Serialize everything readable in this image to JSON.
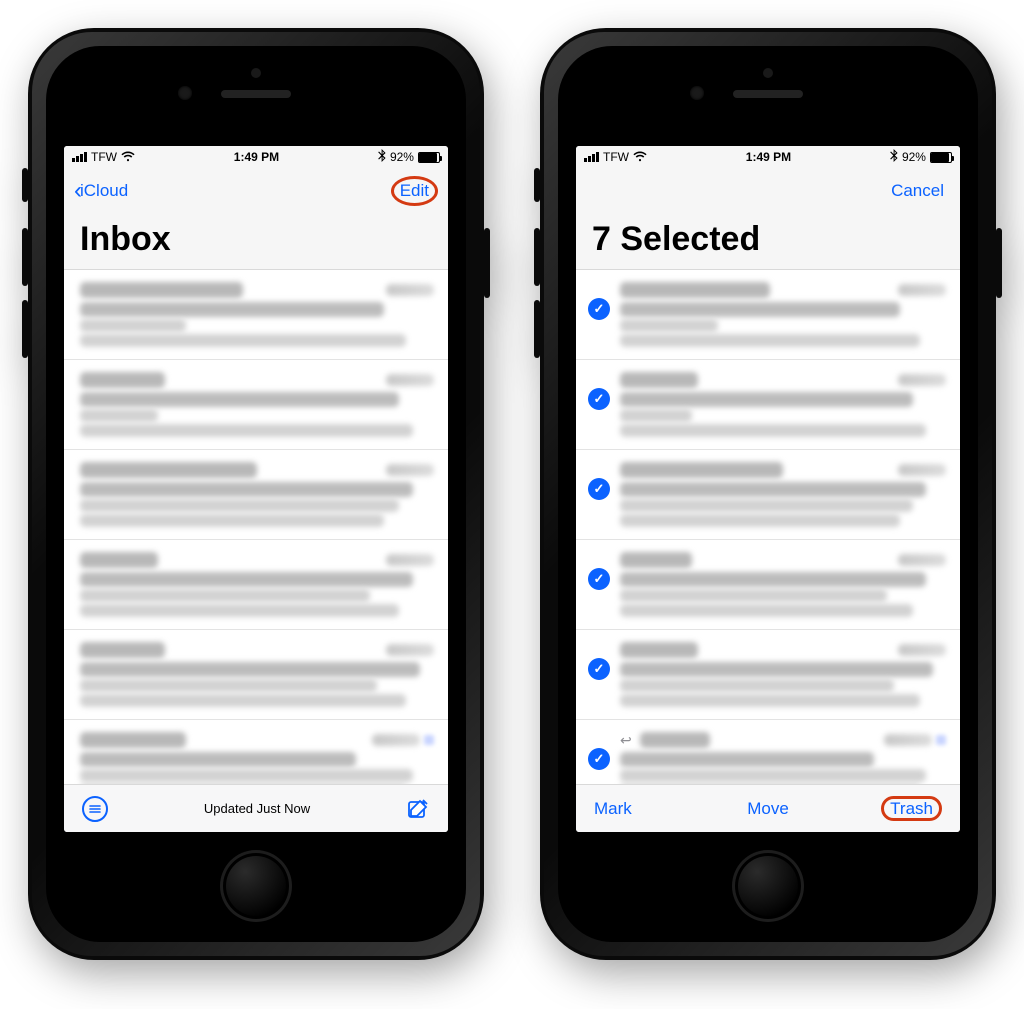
{
  "status": {
    "carrier": "TFW",
    "time": "1:49 PM",
    "battery_pct": "92%"
  },
  "left": {
    "back_label": "iCloud",
    "edit_label": "Edit",
    "title": "Inbox",
    "toolbar_status": "Updated Just Now"
  },
  "right": {
    "cancel_label": "Cancel",
    "title": "7 Selected",
    "mark_label": "Mark",
    "move_label": "Move",
    "trash_label": "Trash"
  }
}
